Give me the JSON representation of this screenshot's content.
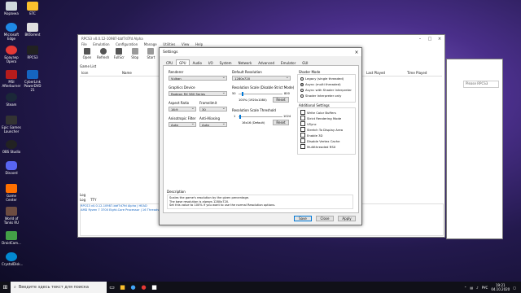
{
  "desktop": {
    "icons_col1": [
      "Корзина",
      "Microsoft Edge",
      "Браузер Opera",
      "MSI Afterburner",
      "Steam",
      "Epic Games Launcher",
      "OBS Studio",
      "Discord",
      "Game Center",
      "World of Tanks RU",
      "DroidCam...",
      "CrystalDisk..."
    ],
    "icons_col2": [
      "ETC",
      "BKTorrent",
      "RPCS3",
      "CyberLink PowerDVD 21"
    ]
  },
  "main_window": {
    "title": "RPCS3 v0.0.12-10987-bbf7d7fd Alpha",
    "menu": [
      "File",
      "Emulation",
      "Configuration",
      "Manage",
      "Utilities",
      "View",
      "Help"
    ],
    "toolbar": [
      "Open",
      "Refresh",
      "FullScr",
      "Stop",
      "Start",
      "Config"
    ],
    "gamelist_label": "Game List",
    "columns": [
      "Icon",
      "Name",
      "Last Played",
      "Time Played"
    ],
    "log_label": "Log",
    "log_tabs": [
      "Log",
      "TTY"
    ],
    "log_lines": [
      "RPCS3 v0.0.12-10987-bbf7d7fd Alpha | HEAD",
      "AMD Ryzen 7 3700 Eight-Core Processor | 16 Threads | 15.9"
    ],
    "search_placeholder": "Please RPCS3"
  },
  "dialog": {
    "title": "Settings",
    "tabs": [
      "CPU",
      "GPU",
      "Audio",
      "I/O",
      "System",
      "Network",
      "Advanced",
      "Emulator",
      "GUI"
    ],
    "renderer": {
      "label": "Renderer",
      "value": "Vulkan"
    },
    "graphics_device": {
      "label": "Graphics Device",
      "value": "Radeon RX 580 Series"
    },
    "aspect_ratio": {
      "label": "Aspect Ratio",
      "value": "16:9"
    },
    "framelimit": {
      "label": "Framelimit",
      "value": "30"
    },
    "anisotropic": {
      "label": "Anisotropic Filter",
      "value": "Auto"
    },
    "anti_aliasing": {
      "label": "Anti-Aliasing",
      "value": "Auto"
    },
    "default_resolution": {
      "label": "Default Resolution",
      "value": "1280x720"
    },
    "resolution_scale": {
      "label": "Resolution Scale (Disable Strict Mode)",
      "min": "50",
      "max": "800",
      "value_text": "100% (1920x1080)",
      "reset": "Reset",
      "fraction": 0.07
    },
    "scale_threshold": {
      "label": "Resolution Scale Threshold",
      "min": "1",
      "max": "1024",
      "value_text": "16x16 (Default)",
      "reset": "Reset",
      "fraction": 0.01
    },
    "shader_mode": {
      "label": "Shader Mode",
      "options": [
        "Legacy (single threaded)",
        "Async (multi threaded)",
        "Async with Shader Interpreter",
        "Shader Interpreter only"
      ],
      "selected": 1
    },
    "additional": {
      "label": "Additional Settings",
      "options": [
        "Write Color Buffers",
        "Strict Rendering Mode",
        "VSync",
        "Stretch To Display Area",
        "Enable 3D",
        "Disable Vertex Cache",
        "Multithreaded RSX"
      ]
    },
    "description_label": "Description",
    "description": [
      "Scales the game's resolution by the given percentage.",
      "The base resolution is always 1280x720.",
      "Set this value to 100% if you want to use the normal Resolution options."
    ],
    "buttons": {
      "save": "Save",
      "close": "Close",
      "apply": "Apply"
    }
  },
  "taskbar": {
    "search_placeholder": "Введите здесь текст для поиска",
    "lang": "РУС",
    "time": "19:21",
    "date": "04.10.2020"
  }
}
